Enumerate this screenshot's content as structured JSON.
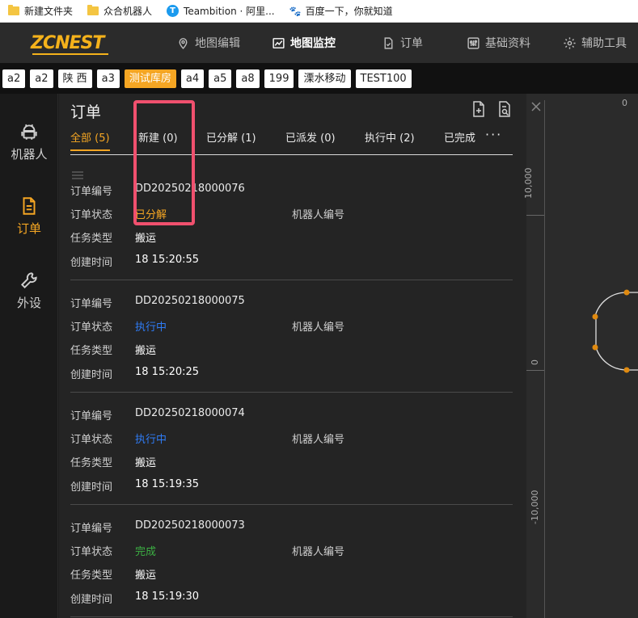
{
  "bookmarks": [
    {
      "label": "新建文件夹",
      "icon": "folder-icon"
    },
    {
      "label": "众合机器人",
      "icon": "folder-icon"
    },
    {
      "label": "Teambition · 阿里...",
      "icon": "teambition-icon"
    },
    {
      "label": "百度一下，你就知道",
      "icon": "baidu-paw-icon"
    }
  ],
  "brand": {
    "logo_text": "ZCNEST",
    "accent_color": "#f5a623"
  },
  "nav": {
    "map_edit": "地图编辑",
    "map_monitor": "地图监控",
    "orders": "订单",
    "basic_data": "基础资料",
    "tools": "辅助工具"
  },
  "tags": [
    "a2",
    "a2",
    "陕 西",
    "a3",
    "测试库房",
    "a4",
    "a5",
    "a8",
    "199",
    "溧水移动",
    "TEST100"
  ],
  "active_tag": "测试库房",
  "sidebar": {
    "robot": "机器人",
    "orders": "订单",
    "peripherals": "外设"
  },
  "panel": {
    "title": "订单",
    "tabs": [
      {
        "label": "全部 (5)"
      },
      {
        "label": "新建 (0)"
      },
      {
        "label": "已分解 (1)"
      },
      {
        "label": "已派发 (0)"
      },
      {
        "label": "执行中 (2)"
      },
      {
        "label": "已完成"
      }
    ],
    "more": "···",
    "field_labels": {
      "order_no": "订单编号",
      "order_status": "订单状态",
      "task_type": "任务类型",
      "create_time": "创建时间",
      "robot_no": "机器人编号"
    },
    "orders": [
      {
        "order_no": "DD20250218000076",
        "status": "已分解",
        "status_color": "#f5a623",
        "task_type": "搬运",
        "create_time": "18 15:20:55"
      },
      {
        "order_no": "DD20250218000075",
        "status": "执行中",
        "status_color": "#2f7cf6",
        "task_type": "搬运",
        "create_time": "18 15:20:25"
      },
      {
        "order_no": "DD20250218000074",
        "status": "执行中",
        "status_color": "#2f7cf6",
        "task_type": "搬运",
        "create_time": "18 15:19:35"
      },
      {
        "order_no": "DD20250218000073",
        "status": "完成",
        "status_color": "#3cb043",
        "task_type": "搬运",
        "create_time": "18 15:19:30"
      }
    ]
  },
  "map": {
    "axis_x_top": "0",
    "axis_y_labels": [
      "10,000",
      "0",
      "-10,000"
    ],
    "path_color": "#e0e0e0",
    "node_color": "#e08a10"
  },
  "highlight_color": "#f0506e"
}
